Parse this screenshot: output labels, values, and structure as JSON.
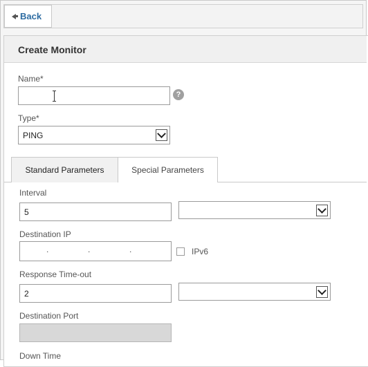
{
  "toolbar": {
    "back_label": "Back"
  },
  "panel": {
    "title": "Create Monitor"
  },
  "form": {
    "name_label": "Name*",
    "name_value": "",
    "help_glyph": "?",
    "type_label": "Type*",
    "type_value": "PING"
  },
  "tabs": [
    {
      "label": "Standard Parameters",
      "active": true
    },
    {
      "label": "Special Parameters",
      "active": false
    }
  ],
  "standard": {
    "interval_label": "Interval",
    "interval_value": "5",
    "interval_unit_value": "",
    "dest_ip_label": "Destination IP",
    "ip_separator": ".",
    "ipv6_label": "IPv6",
    "ipv6_checked": false,
    "response_timeout_label": "Response Time-out",
    "response_timeout_value": "2",
    "response_timeout_unit_value": "",
    "dest_port_label": "Destination Port",
    "dest_port_value": "",
    "down_time_label": "Down Time"
  }
}
